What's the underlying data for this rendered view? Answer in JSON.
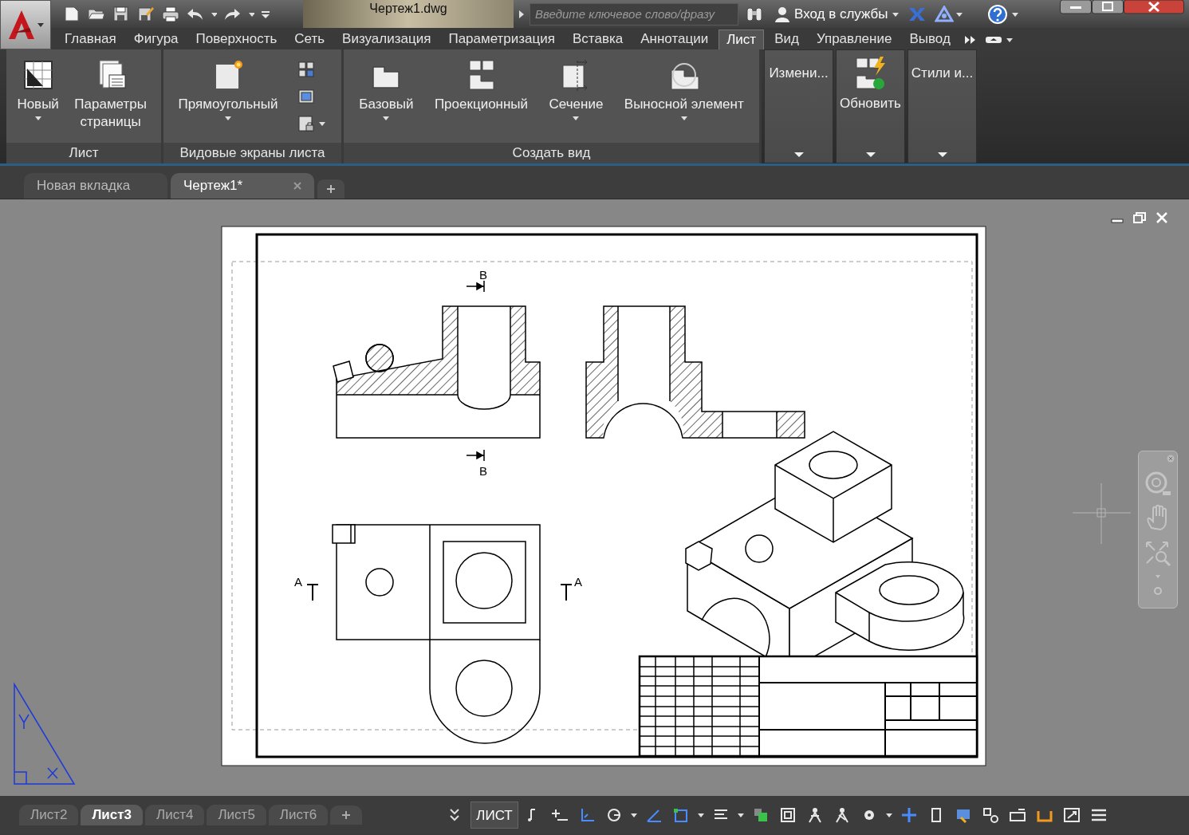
{
  "title": "Чертеж1.dwg",
  "search": {
    "placeholder": "Введите ключевое слово/фразу"
  },
  "sign_in": "Вход в службы",
  "ribbon_tabs": [
    {
      "label": "Главная",
      "selected": false
    },
    {
      "label": "Фигура",
      "selected": false
    },
    {
      "label": "Поверхность",
      "selected": false
    },
    {
      "label": "Сеть",
      "selected": false
    },
    {
      "label": "Визуализация",
      "selected": false
    },
    {
      "label": "Параметризация",
      "selected": false
    },
    {
      "label": "Вставка",
      "selected": false
    },
    {
      "label": "Аннотации",
      "selected": false
    },
    {
      "label": "Лист",
      "selected": true
    },
    {
      "label": "Вид",
      "selected": false
    },
    {
      "label": "Управление",
      "selected": false
    },
    {
      "label": "Вывод",
      "selected": false
    }
  ],
  "ribbon_panels": [
    {
      "title": "Лист",
      "buttons": [
        {
          "label": "Новый",
          "dropdown": true
        },
        {
          "label": "Параметры страницы",
          "dropdown": false
        }
      ]
    },
    {
      "title": "Видовые экраны листа",
      "buttons": [
        {
          "label": "Прямоугольный",
          "dropdown": true
        }
      ],
      "small_buttons": [
        {
          "dropdown": false
        },
        {
          "dropdown": false
        },
        {
          "dropdown": true
        }
      ]
    },
    {
      "title": "Создать вид",
      "buttons": [
        {
          "label": "Базовый",
          "dropdown": true
        },
        {
          "label": "Проекционный",
          "dropdown": false
        },
        {
          "label": "Сечение",
          "dropdown": true
        },
        {
          "label": "Выносной элемент",
          "dropdown": true
        }
      ]
    }
  ],
  "collapsed_panels": [
    {
      "label": "Измени...",
      "kind": "label"
    },
    {
      "label": "Обновить",
      "kind": "icon"
    },
    {
      "label": "Стили и...",
      "kind": "label"
    }
  ],
  "doc_tabs": [
    {
      "label": "Новая вкладка",
      "selected": false
    },
    {
      "label": "Чертеж1*",
      "selected": true
    }
  ],
  "drawing": {
    "section_letters": [
      "В",
      "В",
      "А",
      "А"
    ]
  },
  "layout_tabs": [
    {
      "label": "Лист2",
      "selected": false
    },
    {
      "label": "Лист3",
      "selected": true
    },
    {
      "label": "Лист4",
      "selected": false
    },
    {
      "label": "Лист5",
      "selected": false
    },
    {
      "label": "Лист6",
      "selected": false
    }
  ],
  "status_bar": {
    "space": "ЛИСТ"
  }
}
